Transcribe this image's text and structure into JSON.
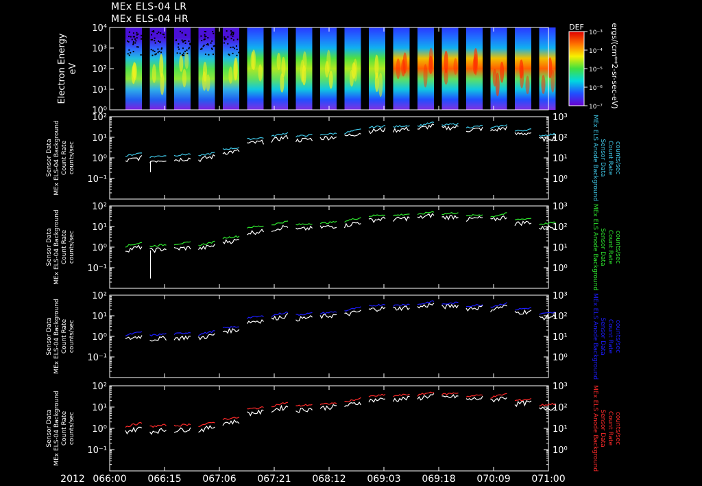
{
  "titles": [
    "MEx ELS-04 LR",
    "MEx ELS-04 HR"
  ],
  "year_label": "2012",
  "x_ticks": [
    "066:00",
    "066:15",
    "067:06",
    "067:21",
    "068:12",
    "069:03",
    "069:18",
    "070:09",
    "071:00"
  ],
  "colors": {
    "background": "#000000",
    "axes": "#ffffff",
    "white_trace": "#ffffff",
    "cyan_trace": "#40c8e8",
    "green_trace": "#2ee82e",
    "blue_trace": "#1c1cff",
    "red_trace": "#ff2a2a"
  },
  "chart_data": [
    {
      "type": "heatmap",
      "ylabel": [
        "Electron Energy",
        "eV"
      ],
      "y_ticks": [
        "10⁴",
        "10³",
        "10²",
        "10¹",
        "10⁰"
      ],
      "ylim": [
        1,
        10000
      ],
      "yscale": "log",
      "colorbar": {
        "title": "DEF",
        "ticks": [
          "10⁻³",
          "10⁻⁴",
          "10⁻⁵",
          "10⁻⁶",
          "10⁻⁷"
        ],
        "label": "ergs/(cm**2-sr-sec-eV)"
      },
      "intervals": 18
    },
    {
      "type": "line",
      "left_label": [
        "Sensor Data",
        "MEx ELS-04 Background",
        "Count Rate",
        "counts/sec"
      ],
      "right_label": [
        "MEx ELS Anode Background",
        "Sensor Data",
        "Count Rate",
        "counts/sec"
      ],
      "left_ticks": [
        "10²",
        "10¹",
        "10⁰",
        "10⁻¹"
      ],
      "right_ticks": [
        "10³",
        "10²",
        "10¹",
        "10⁰"
      ],
      "ylim": [
        0.01,
        100
      ],
      "yscale": "log",
      "series": [
        {
          "color": "#ffffff",
          "values": [
            0.7,
            0.7,
            0.8,
            0.8,
            1.8,
            5,
            7,
            7,
            9,
            11,
            20,
            22,
            25,
            27,
            22,
            20,
            14,
            8
          ]
        },
        {
          "color": "#40c8e8",
          "values": [
            1.2,
            1.1,
            1.3,
            1.2,
            2.6,
            8,
            11,
            11,
            13,
            16,
            30,
            32,
            35,
            38,
            30,
            27,
            20,
            12
          ]
        }
      ]
    },
    {
      "type": "line",
      "left_label": [
        "Sensor Data",
        "MEx ELS-04 Background",
        "Count Rate",
        "counts/sec"
      ],
      "right_label": [
        "MEx ELS Anode Background",
        "Sensor Data",
        "Count Rate",
        "counts/sec"
      ],
      "left_ticks": [
        "10²",
        "10¹",
        "10⁰",
        "10⁻¹"
      ],
      "right_ticks": [
        "10³",
        "10²",
        "10¹",
        "10⁰"
      ],
      "ylim": [
        0.01,
        100
      ],
      "yscale": "log",
      "series": [
        {
          "color": "#ffffff",
          "values": [
            0.7,
            0.7,
            0.8,
            0.8,
            1.8,
            5,
            7,
            7,
            9,
            11,
            20,
            22,
            25,
            27,
            22,
            20,
            14,
            8
          ]
        },
        {
          "color": "#2ee82e",
          "values": [
            1.1,
            1.1,
            1.4,
            1.2,
            2.8,
            9,
            12,
            12,
            14,
            18,
            32,
            34,
            36,
            40,
            32,
            29,
            21,
            13
          ]
        }
      ]
    },
    {
      "type": "line",
      "left_label": [
        "Sensor Data",
        "MEx ELS-04 Background",
        "Count Rate",
        "counts/sec"
      ],
      "right_label": [
        "MEx ELS Anode Background",
        "Sensor Data",
        "Count Rate",
        "counts/sec"
      ],
      "left_ticks": [
        "10²",
        "10¹",
        "10⁰",
        "10⁻¹"
      ],
      "right_ticks": [
        "10³",
        "10²",
        "10¹",
        "10⁰"
      ],
      "ylim": [
        0.01,
        100
      ],
      "yscale": "log",
      "series": [
        {
          "color": "#ffffff",
          "values": [
            0.7,
            0.7,
            0.8,
            0.8,
            1.8,
            5,
            7,
            7,
            9,
            11,
            20,
            22,
            25,
            27,
            22,
            20,
            14,
            8
          ]
        },
        {
          "color": "#1c1cff",
          "values": [
            1.1,
            1.1,
            1.3,
            1.2,
            2.5,
            8,
            10,
            11,
            13,
            17,
            30,
            31,
            34,
            36,
            29,
            27,
            20,
            12
          ]
        }
      ]
    },
    {
      "type": "line",
      "left_label": [
        "Sensor Data",
        "MEx ELS-04 Background",
        "Count Rate",
        "counts/sec"
      ],
      "right_label": [
        "MEx ELS Anode Background",
        "Sensor Data",
        "Count Rate",
        "counts/sec"
      ],
      "left_ticks": [
        "10²",
        "10¹",
        "10⁰",
        "10⁻¹"
      ],
      "right_ticks": [
        "10³",
        "10²",
        "10¹",
        "10⁰"
      ],
      "ylim": [
        0.01,
        100
      ],
      "yscale": "log",
      "series": [
        {
          "color": "#ffffff",
          "values": [
            0.7,
            0.7,
            0.8,
            0.8,
            1.8,
            5,
            7,
            7,
            9,
            11,
            20,
            22,
            25,
            27,
            22,
            20,
            14,
            8
          ]
        },
        {
          "color": "#ff2a2a",
          "values": [
            1.2,
            1.2,
            1.3,
            1.3,
            2.7,
            8,
            11,
            11,
            13,
            17,
            31,
            33,
            35,
            39,
            31,
            28,
            20,
            12
          ]
        }
      ]
    }
  ]
}
